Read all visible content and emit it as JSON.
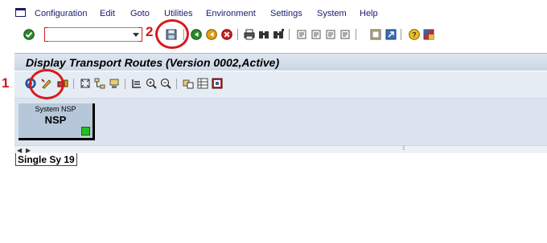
{
  "menu": {
    "items": [
      {
        "label": "Configuration"
      },
      {
        "label": "Edit"
      },
      {
        "label": "Goto"
      },
      {
        "label": "Utilities"
      },
      {
        "label": "Environment"
      },
      {
        "label": "Settings"
      },
      {
        "label": "System"
      },
      {
        "label": "Help"
      }
    ]
  },
  "command_field": {
    "value": ""
  },
  "toolbar_icons": [
    "enter-check-icon",
    "save-icon",
    "back-icon",
    "exit-icon",
    "cancel-icon",
    "print-icon",
    "find-icon",
    "find-next-icon",
    "first-page-icon",
    "previous-page-icon",
    "next-page-icon",
    "last-page-icon",
    "new-session-icon",
    "shortcut-icon",
    "help-icon",
    "layout-menu-icon"
  ],
  "title": "Display Transport Routes (Version 0002,Active)",
  "app_toolbar_icons": [
    "refresh-icon",
    "display-change-icon",
    "transport-icon",
    "fit-screen-icon",
    "tree-icon",
    "system-icon",
    "list-icon",
    "zoom-in-icon",
    "zoom-out-icon",
    "object-icon",
    "table-icon",
    "legend-icon"
  ],
  "system_box": {
    "label": "System NSP",
    "id": "NSP"
  },
  "status": "Single Sy 19",
  "annotations": {
    "one": "1",
    "two": "2"
  },
  "colors": {
    "annotation": "#d81a1a",
    "title_bg": "#c9d6e4",
    "system_box": "#b7c7da",
    "status_green": "#22c022"
  }
}
